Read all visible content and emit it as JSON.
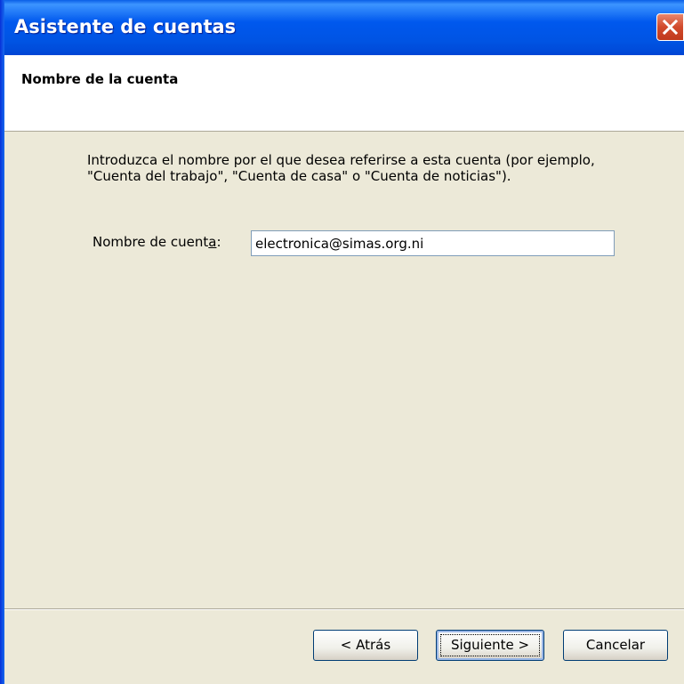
{
  "window": {
    "title": "Asistente de cuentas",
    "close_icon": "close-icon"
  },
  "header": {
    "title": "Nombre de la cuenta"
  },
  "content": {
    "description": "Introduzca el nombre por el que desea referirse a esta cuenta (por ejemplo, \"Cuenta del trabajo\", \"Cuenta de casa\" o \"Cuenta de noticias\").",
    "field_label_prefix": "Nombre de cuent",
    "field_label_accesskey": "a",
    "field_label_suffix": ":",
    "account_name_value": "electronica@simas.org.ni"
  },
  "footer": {
    "back_label": "< Atrás",
    "next_label": "Siguiente >",
    "cancel_label": "Cancelar"
  },
  "colors": {
    "titlebar": "#0054e3",
    "dialog_bg": "#ece9d8",
    "close_button": "#d14a2c"
  }
}
